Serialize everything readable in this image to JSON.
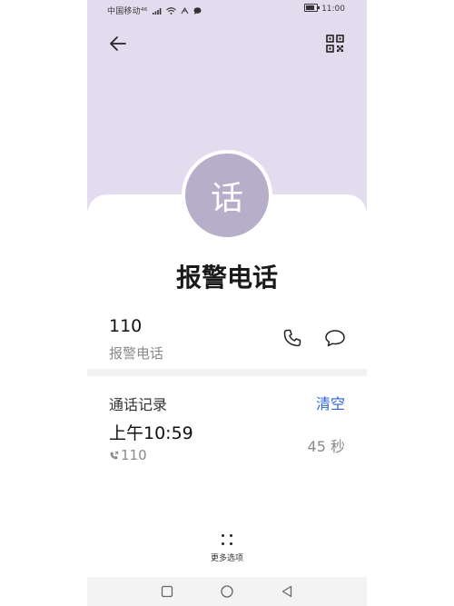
{
  "status_bar": {
    "carrier": "中国移动",
    "network": "⁴⁶",
    "time": "11:00"
  },
  "header": {
    "back_icon": "arrow-left-icon",
    "qr_icon": "qr-code-icon",
    "background_color": "#e3dcee"
  },
  "contact": {
    "avatar_text": "话",
    "avatar_color": "#b7aec9",
    "name": "报警电话",
    "number": "110",
    "number_label": "报警电话",
    "call_icon": "phone-icon",
    "message_icon": "message-icon"
  },
  "history": {
    "title": "通话记录",
    "clear_label": "清空",
    "accent_color": "#2b63d9",
    "entries": [
      {
        "time": "上午10:59",
        "number": "110",
        "duration": "45 秒"
      }
    ]
  },
  "footer": {
    "more_label": "更多选项"
  },
  "nav_bar": [
    "square-icon",
    "circle-icon",
    "triangle-back-icon"
  ]
}
